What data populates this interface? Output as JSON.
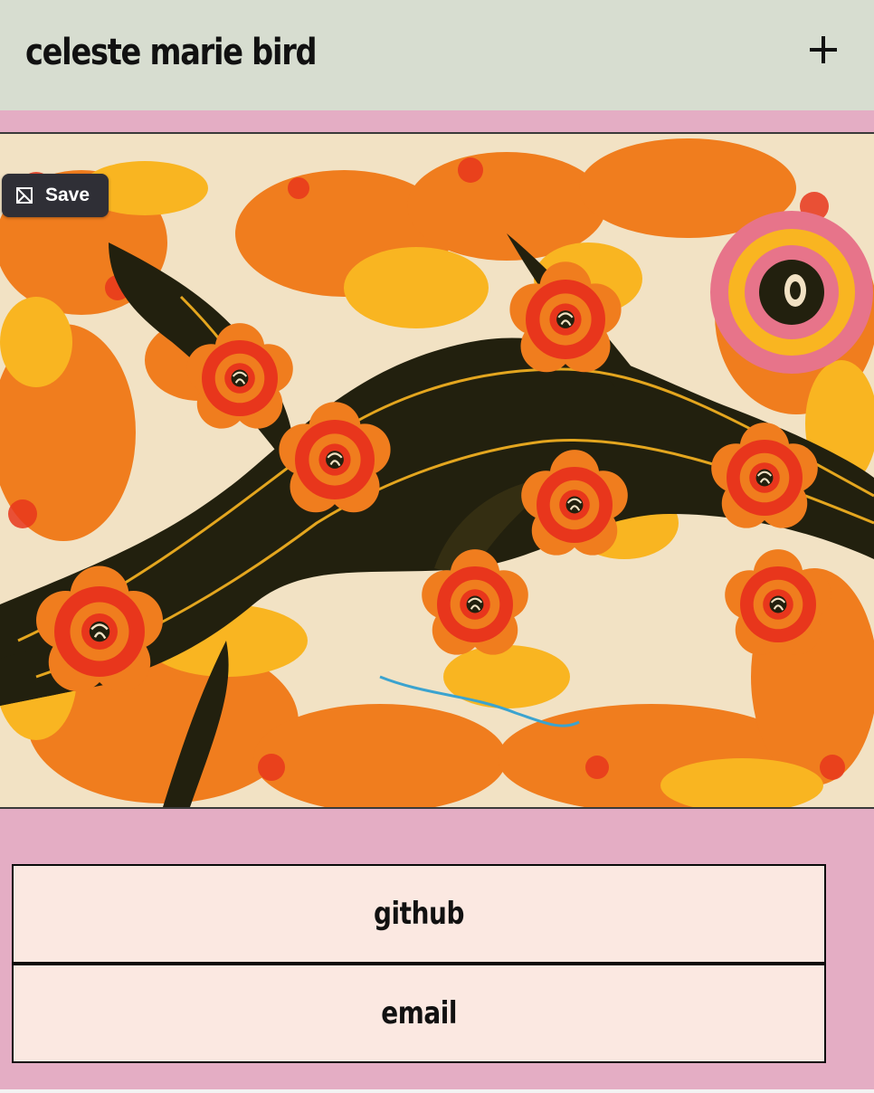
{
  "header": {
    "title": "celeste marie bird",
    "menu_icon": "plus-icon"
  },
  "artwork": {
    "description_icon": "marbled-paper-artwork",
    "save_label": "Save",
    "save_icon": "pin-save-icon",
    "colors": {
      "orange": "#f07d1e",
      "red": "#e8361c",
      "yellow": "#f9b521",
      "black": "#22200e",
      "cream": "#f2e2c4",
      "pink": "#e7748a"
    }
  },
  "links": [
    {
      "label": "github"
    },
    {
      "label": "email"
    }
  ],
  "colors": {
    "header_bg": "#d7ddd0",
    "page_bg": "#e4adc4",
    "link_bg": "#fbe8e1"
  }
}
